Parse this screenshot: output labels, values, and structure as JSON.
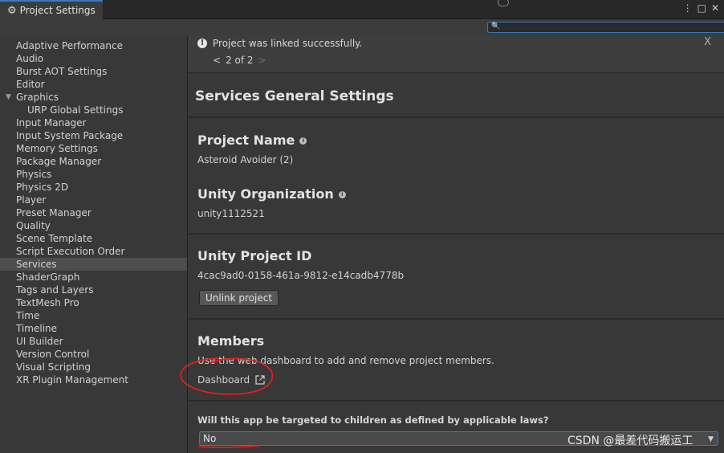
{
  "window": {
    "tab_title": "Project Settings",
    "tab_icon": "gear-icon",
    "controls": [
      "more-icon",
      "maximize-icon",
      "close-icon"
    ]
  },
  "search": {
    "placeholder": "",
    "value": ""
  },
  "sidebar": {
    "items": [
      {
        "label": "Adaptive Performance"
      },
      {
        "label": "Audio"
      },
      {
        "label": "Burst AOT Settings"
      },
      {
        "label": "Editor"
      },
      {
        "label": "Graphics",
        "expanded": true
      },
      {
        "label": "URP Global Settings",
        "child": true
      },
      {
        "label": "Input Manager"
      },
      {
        "label": "Input System Package"
      },
      {
        "label": "Memory Settings"
      },
      {
        "label": "Package Manager"
      },
      {
        "label": "Physics"
      },
      {
        "label": "Physics 2D"
      },
      {
        "label": "Player"
      },
      {
        "label": "Preset Manager"
      },
      {
        "label": "Quality"
      },
      {
        "label": "Scene Template"
      },
      {
        "label": "Script Execution Order"
      },
      {
        "label": "Services",
        "selected": true
      },
      {
        "label": "ShaderGraph"
      },
      {
        "label": "Tags and Layers"
      },
      {
        "label": "TextMesh Pro"
      },
      {
        "label": "Time"
      },
      {
        "label": "Timeline"
      },
      {
        "label": "UI Builder"
      },
      {
        "label": "Version Control"
      },
      {
        "label": "Visual Scripting"
      },
      {
        "label": "XR Plugin Management"
      }
    ]
  },
  "notice": {
    "message": "Project was linked successfully.",
    "close_label": "X",
    "pager_prev": "<",
    "pager_text": "2 of 2",
    "pager_next": ">"
  },
  "main": {
    "heading": "Services General Settings",
    "project_name_label": "Project Name",
    "project_name_value": "Asteroid Avoider (2)",
    "organization_label": "Unity Organization",
    "organization_value": "unity1112521",
    "project_id_label": "Unity Project ID",
    "project_id_value": "4cac9ad0-0158-461a-9812-e14cadb4778b",
    "unlink_label": "Unlink project",
    "members_label": "Members",
    "members_desc": "Use the web dashboard to add and remove project members.",
    "dashboard_label": "Dashboard",
    "children_question": "Will this app be targeted to children as defined by applicable laws?",
    "children_value": "No"
  },
  "watermark": "CSDN @最差代码搬运工",
  "colors": {
    "accent": "#3a79bb",
    "annotation_red": "#e02020"
  }
}
